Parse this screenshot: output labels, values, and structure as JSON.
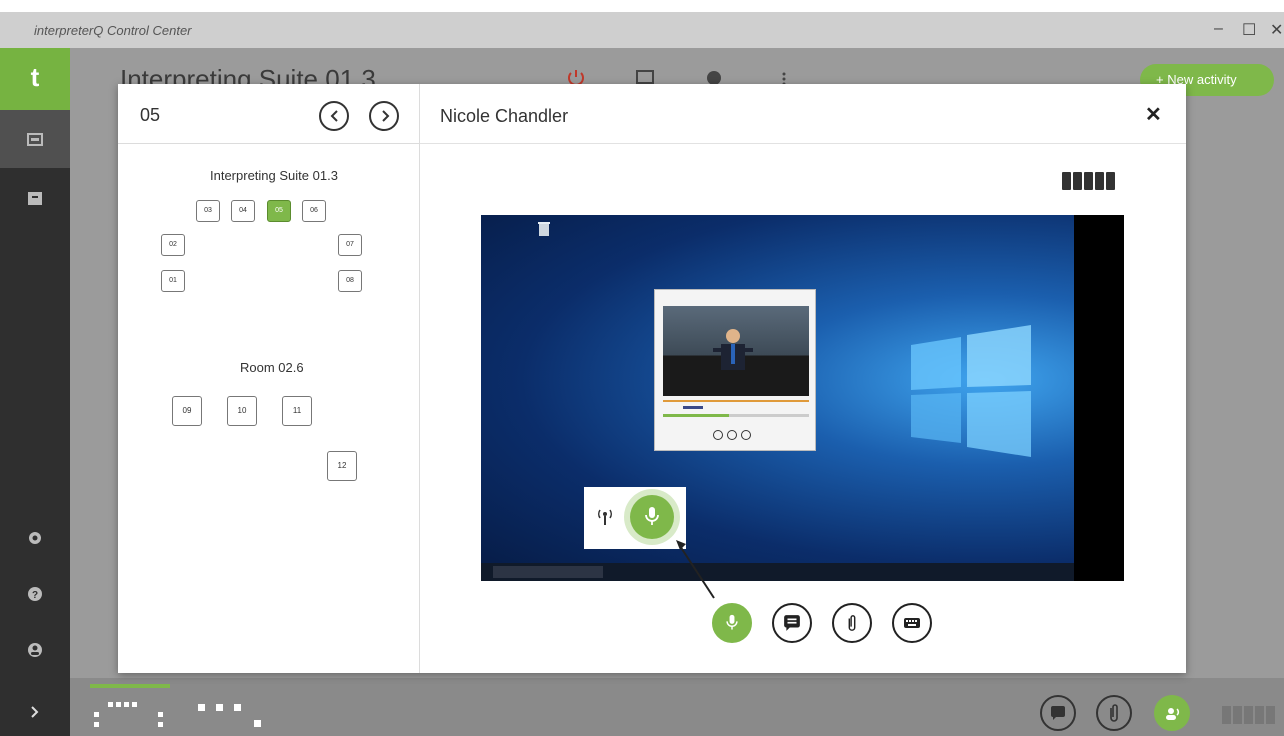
{
  "window": {
    "title": "interpreterQ Control Center",
    "controls": [
      "–",
      "☐",
      "✕"
    ]
  },
  "app": {
    "logo_text": "t",
    "page_title": "Interpreting Suite 01.3",
    "new_activity_label": "New activity",
    "new_activity_icon": "plus"
  },
  "colors": {
    "accent_green": "#7fb84a",
    "sidebar_dark": "#2f2f2f"
  },
  "modal": {
    "seat_number": "05",
    "interpreter_name": "Nicole Chandler",
    "close_icon": "✕",
    "rooms": [
      {
        "name": "Interpreting Suite 01.3",
        "seats": [
          "03",
          "04",
          "05",
          "06",
          "02",
          "07",
          "01",
          "08"
        ]
      },
      {
        "name": "Room 02.6",
        "seats": [
          "09",
          "10",
          "11",
          "12"
        ]
      }
    ],
    "active_seat": "05",
    "actions": [
      "microphone",
      "chat",
      "attachment",
      "keyboard"
    ]
  },
  "bottom_actions": [
    "chat",
    "attachment",
    "group-talk"
  ]
}
